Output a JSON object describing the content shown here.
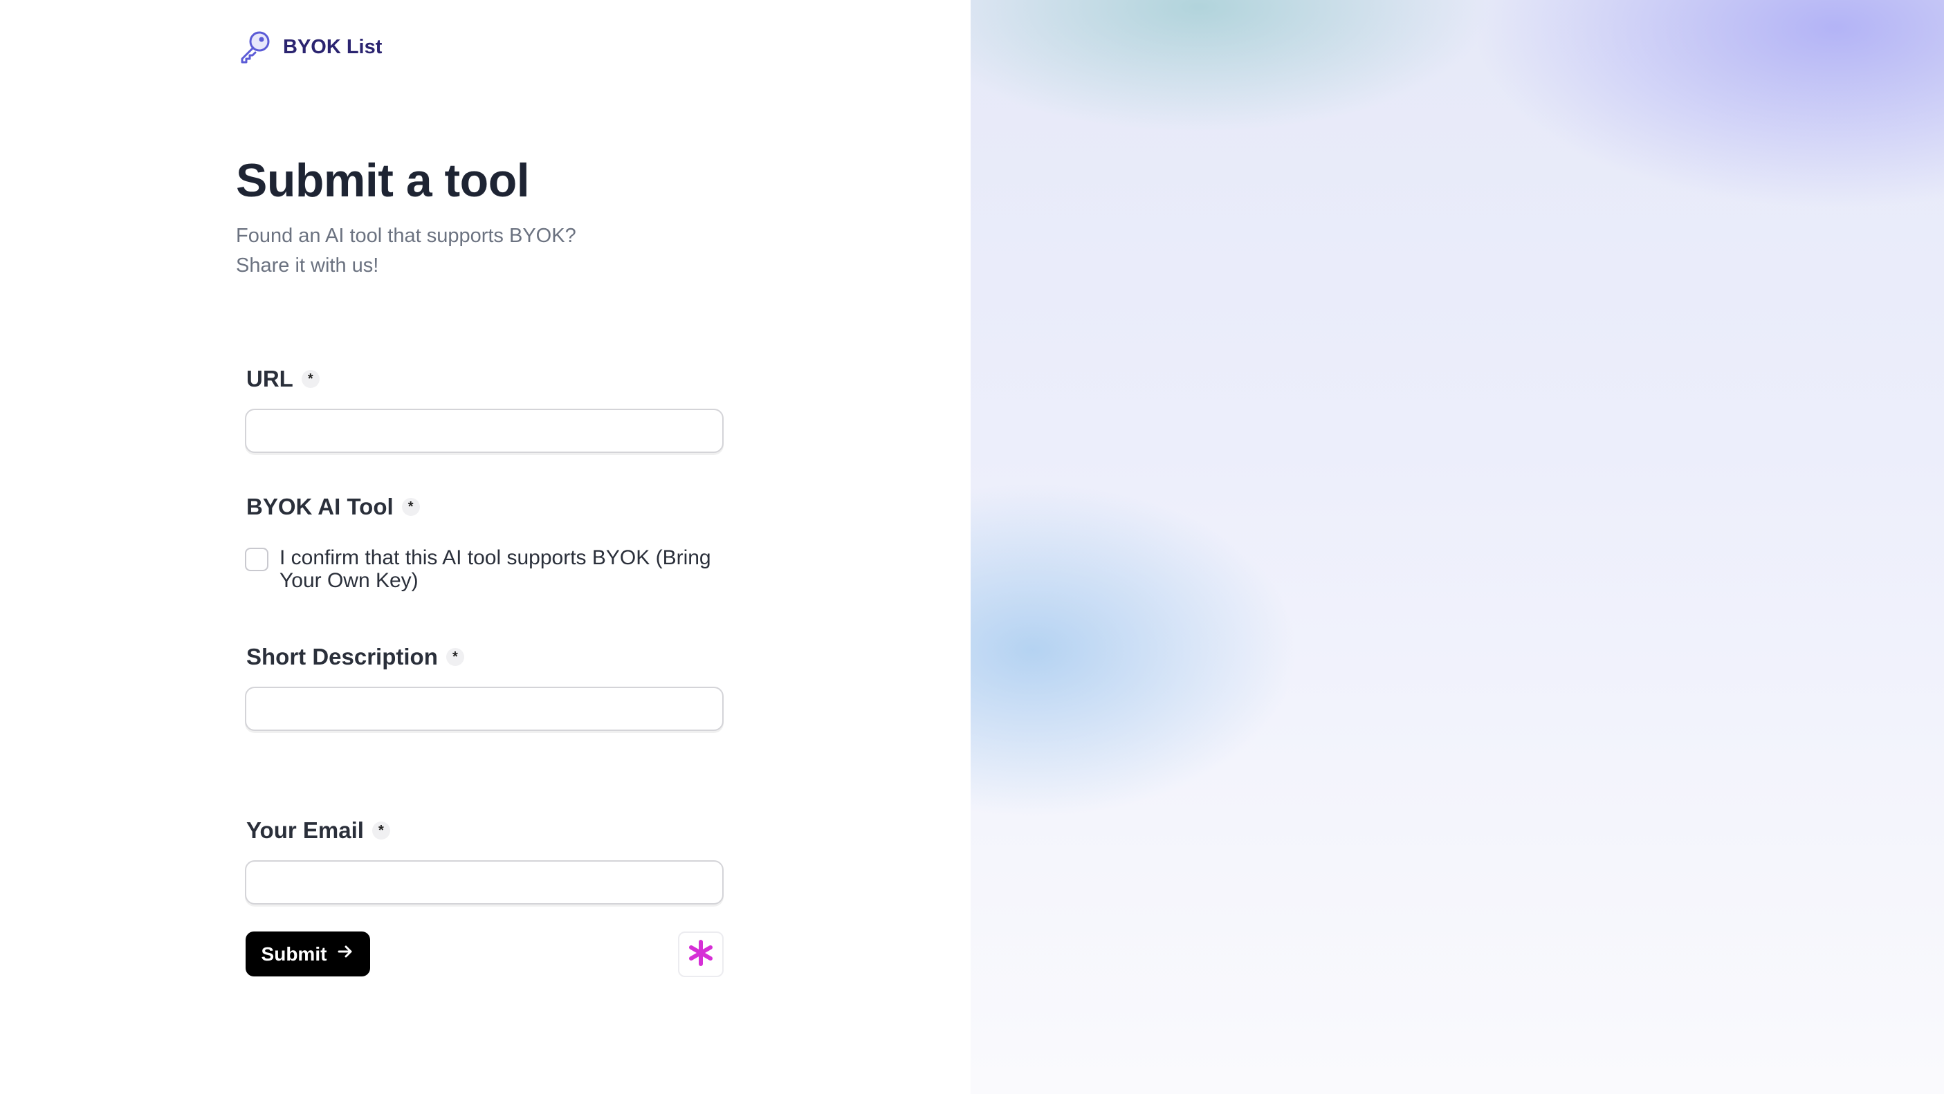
{
  "brand": {
    "name": "BYOK List",
    "icon": "key-icon",
    "icon_color": "#5b5bd6"
  },
  "header": {
    "title": "Submit a tool",
    "subtitle_line1": "Found an AI tool that supports BYOK?",
    "subtitle_line2": "Share it with us!"
  },
  "form": {
    "url": {
      "label": "URL",
      "required_mark": "*",
      "value": "",
      "placeholder": ""
    },
    "byok": {
      "label": "BYOK AI Tool",
      "required_mark": "*",
      "checkbox_label": "I confirm that this AI tool supports BYOK (Bring Your Own Key)",
      "checked": false
    },
    "description": {
      "label": "Short Description",
      "required_mark": "*",
      "value": "",
      "placeholder": ""
    },
    "email": {
      "label": "Your Email",
      "required_mark": "*",
      "value": "",
      "placeholder": ""
    },
    "submit": {
      "label": "Submit",
      "icon": "arrow-right-icon"
    },
    "badge": {
      "icon": "asterisk-icon",
      "color": "#d62fd6"
    }
  },
  "colors": {
    "accent": "#2b2470",
    "button_bg": "#000000"
  }
}
